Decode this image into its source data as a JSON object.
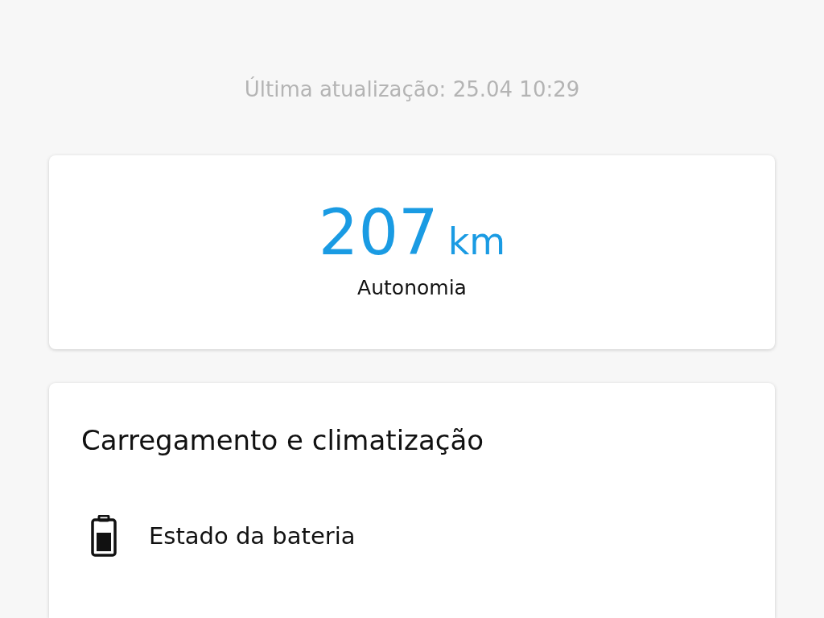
{
  "last_update": "Última atualização: 25.04 10:29",
  "range_card": {
    "value": "207",
    "unit": "km",
    "label": "Autonomia"
  },
  "charging_card": {
    "title": "Carregamento e climatização",
    "items": [
      {
        "kind": "battery",
        "label": "Estado da bateria"
      }
    ]
  }
}
